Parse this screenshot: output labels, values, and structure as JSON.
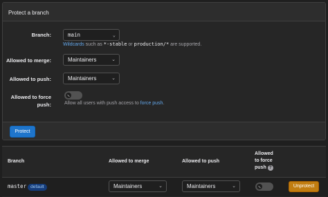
{
  "protect_form": {
    "title": "Protect a branch",
    "branch_label": "Branch:",
    "branch_value": "main",
    "wildcard_link": "Wildcards",
    "wildcard_text_1": " such as ",
    "wildcard_code_1": "*-stable",
    "wildcard_text_2": " or ",
    "wildcard_code_2": "production/*",
    "wildcard_text_3": " are supported.",
    "merge_label": "Allowed to merge:",
    "merge_value": "Maintainers",
    "push_label": "Allowed to push:",
    "push_value": "Maintainers",
    "force_label_1": "Allowed to force",
    "force_label_2": "push:",
    "force_help_text": "Allow all users with push access to ",
    "force_help_link": "force push",
    "force_help_end": ".",
    "protect_button": "Protect"
  },
  "table": {
    "headers": {
      "branch": "Branch",
      "merge": "Allowed to merge",
      "push": "Allowed to push",
      "force_1": "Allowed",
      "force_2": "to force",
      "force_3": "push"
    },
    "rows": [
      {
        "branch": "master",
        "badge": "default",
        "merge": "Maintainers",
        "push": "Maintainers",
        "force_push_enabled": false,
        "action": "Unprotect"
      }
    ]
  },
  "icons": {
    "chevron": "chevron-down-icon",
    "help": "question-icon"
  },
  "colors": {
    "primary": "#1f75cb",
    "warning": "#c17d10",
    "link": "#63a6e9"
  }
}
